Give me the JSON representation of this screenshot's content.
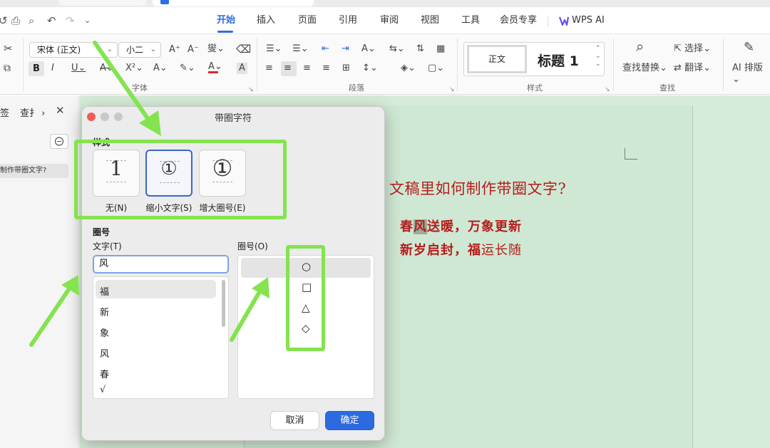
{
  "menu": {
    "tabs": [
      "开始",
      "插入",
      "页面",
      "引用",
      "审阅",
      "视图",
      "工具",
      "会员专享"
    ],
    "active_tab": "开始",
    "wps_ai": "WPS AI"
  },
  "ribbon": {
    "font_name": "宋体 (正文)",
    "font_size": "小二",
    "group_font": "字体",
    "group_paragraph": "段落",
    "style_normal": "正文",
    "style_heading": "标题 1",
    "group_styles": "样式",
    "find_replace": "查找替换",
    "select": "选择",
    "translate": "翻译",
    "group_find": "查找",
    "ai_layout": "AI 排版"
  },
  "nav": {
    "tab_bookmarks": "签",
    "tab_find": "查扌",
    "heading_item": "制作带圈文字?"
  },
  "document": {
    "title": "文稿里如何制作带圈文字?",
    "line1_before": "春",
    "line1_highlight": "风",
    "line1_after": "送暖，万象更新",
    "line2_bold": "新岁启封，福",
    "line2_normal": "运长随"
  },
  "dialog": {
    "title": "带圈字符",
    "section_style": "样式",
    "styles": [
      {
        "label": "无(N)",
        "glyph": "1"
      },
      {
        "label": "缩小文字(S)",
        "glyph": "①"
      },
      {
        "label": "增大圈号(E)",
        "glyph": "①"
      }
    ],
    "selected_style": "缩小文字(S)",
    "section_circle": "圈号",
    "text_label": "文字(T)",
    "text_value": "风",
    "char_list": [
      "福",
      "新",
      "象",
      "风",
      "春",
      "√"
    ],
    "shape_label": "圈号(O)",
    "shapes": [
      "○",
      "□",
      "△",
      "◇"
    ],
    "cancel": "取消",
    "ok": "确定"
  },
  "colors": {
    "accent": "#2f6de1",
    "doc_text": "#b51d1d",
    "doc_bg": "#d6ebd8",
    "annotation": "#84e34f"
  }
}
